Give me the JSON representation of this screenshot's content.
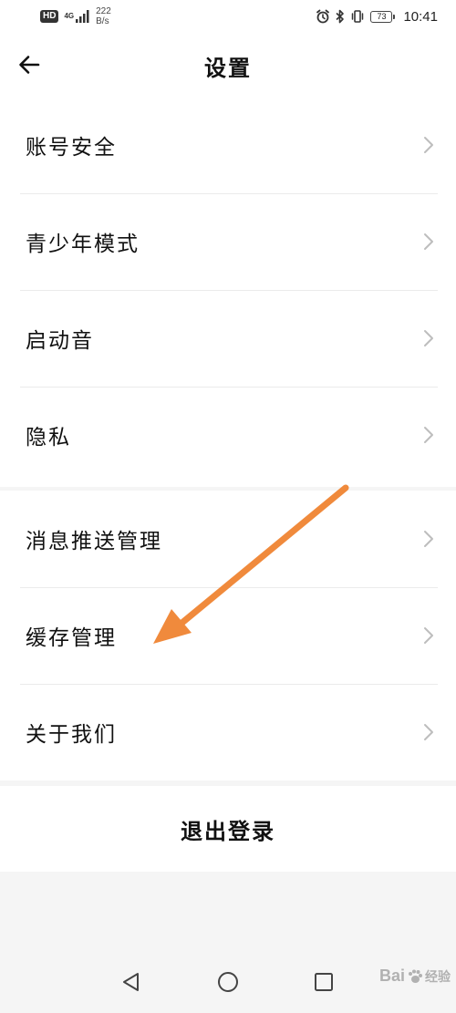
{
  "status_bar": {
    "hd": "HD",
    "network": "4G",
    "speed_value": "222",
    "speed_unit": "B/s",
    "battery": "73",
    "time": "10:41"
  },
  "header": {
    "title": "设置",
    "back_icon": "arrow-left-icon"
  },
  "groups": [
    {
      "items": [
        {
          "label": "账号安全"
        },
        {
          "label": "青少年模式"
        },
        {
          "label": "启动音"
        },
        {
          "label": "隐私"
        }
      ]
    },
    {
      "items": [
        {
          "label": "消息推送管理"
        },
        {
          "label": "缓存管理"
        },
        {
          "label": "关于我们"
        }
      ]
    }
  ],
  "logout": {
    "label": "退出登录"
  },
  "annotation": {
    "color": "#f08a3c",
    "icon": "annotation-arrow"
  },
  "nav_bar": {
    "back_icon": "triangle-back-icon",
    "home_icon": "circle-home-icon",
    "recent_icon": "square-recent-icon"
  },
  "watermark": {
    "text": "Bai",
    "text2": "经验"
  }
}
